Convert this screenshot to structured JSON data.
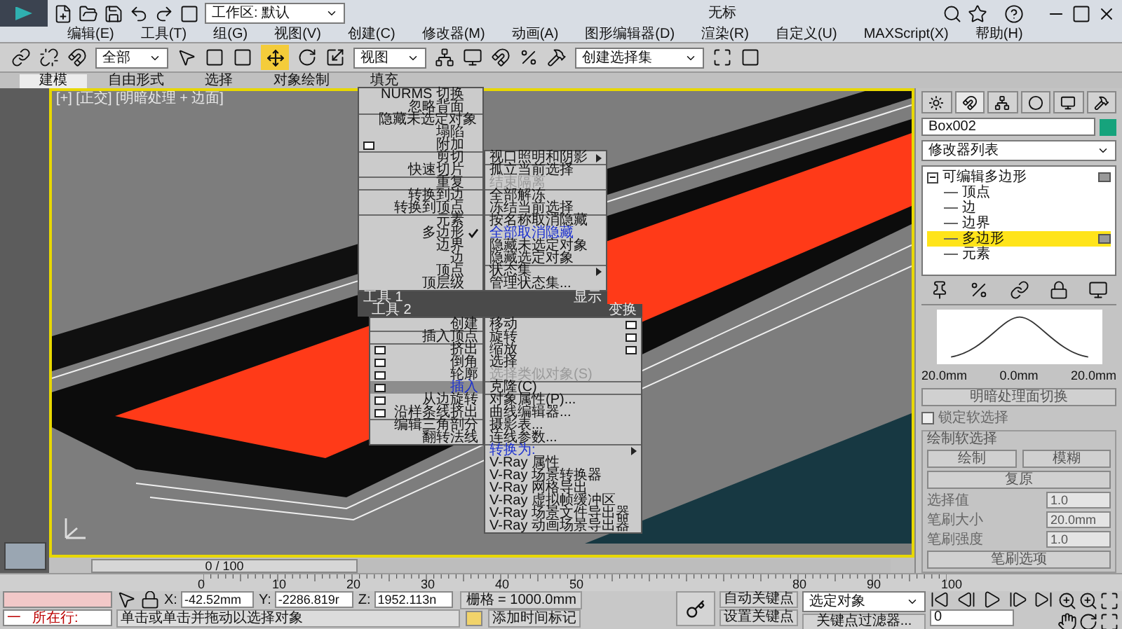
{
  "title_bar": {
    "workspace": "工作区: 默认",
    "title": "无标"
  },
  "menu_bar": [
    "编辑(E)",
    "工具(T)",
    "组(G)",
    "视图(V)",
    "创建(C)",
    "修改器(M)",
    "动画(A)",
    "图形编辑器(D)",
    "渲染(R)",
    "自定义(U)",
    "MAXScript(X)",
    "帮助(H)"
  ],
  "toolbar": {
    "selection_filter": "全部",
    "reference_coord": "视图",
    "named_selection": "创建选择集"
  },
  "ribbon_tabs": [
    {
      "label": "建模",
      "selected": true
    },
    {
      "label": "自由形式",
      "selected": false
    },
    {
      "label": "选择",
      "selected": false
    },
    {
      "label": "对象绘制",
      "selected": false
    },
    {
      "label": "填充",
      "selected": false
    }
  ],
  "viewport": {
    "label": "[+] [正交] [明暗处理 + 边面]"
  },
  "quad_menu": {
    "upper_left": {
      "label": "工具 1",
      "groups": [
        [
          {
            "label": "NURMS 切换",
            "kind": "plain",
            "checked": false,
            "selected": false,
            "disabled": false,
            "highlighted": false
          },
          {
            "label": "忽略背面",
            "kind": "plain",
            "checked": false,
            "selected": false,
            "disabled": false,
            "highlighted": false
          }
        ],
        [
          {
            "label": "隐藏未选定对象",
            "kind": "plain",
            "checked": false,
            "selected": false,
            "disabled": false,
            "highlighted": false
          },
          {
            "label": "塌陷",
            "kind": "plain",
            "checked": false,
            "selected": false,
            "disabled": false,
            "highlighted": false
          },
          {
            "label": "附加",
            "kind": "options",
            "checked": false,
            "selected": false,
            "disabled": false,
            "highlighted": false
          }
        ],
        [
          {
            "label": "剪切",
            "kind": "plain",
            "checked": false,
            "selected": false,
            "disabled": false,
            "highlighted": false
          },
          {
            "label": "快速切片",
            "kind": "plain",
            "checked": false,
            "selected": false,
            "disabled": false,
            "highlighted": false
          }
        ],
        [
          {
            "label": "重复",
            "kind": "plain",
            "checked": false,
            "selected": false,
            "disabled": false,
            "highlighted": false
          }
        ],
        [
          {
            "label": "转换到边",
            "kind": "plain",
            "checked": false,
            "selected": false,
            "disabled": false,
            "highlighted": false
          },
          {
            "label": "转换到顶点",
            "kind": "plain",
            "checked": false,
            "selected": false,
            "disabled": false,
            "highlighted": false
          }
        ],
        [
          {
            "label": "元素",
            "kind": "plain",
            "checked": false,
            "selected": false,
            "disabled": false,
            "highlighted": false
          },
          {
            "label": "多边形",
            "kind": "plain",
            "checked": true,
            "selected": false,
            "disabled": false,
            "highlighted": false
          },
          {
            "label": "边界",
            "kind": "plain",
            "checked": false,
            "selected": false,
            "disabled": false,
            "highlighted": false
          },
          {
            "label": "边",
            "kind": "plain",
            "checked": false,
            "selected": false,
            "disabled": false,
            "highlighted": false
          },
          {
            "label": "顶点",
            "kind": "plain",
            "checked": false,
            "selected": false,
            "disabled": false,
            "highlighted": false
          },
          {
            "label": "顶层级",
            "kind": "plain",
            "checked": false,
            "selected": false,
            "disabled": false,
            "highlighted": false
          }
        ]
      ]
    },
    "upper_right": {
      "label": "显示",
      "groups": [
        [
          {
            "label": "视口照明和阴影",
            "kind": "submenu",
            "selected": false,
            "disabled": false,
            "highlighted": false
          }
        ],
        [
          {
            "label": "孤立当前选择",
            "kind": "plain",
            "selected": false,
            "disabled": false,
            "highlighted": false
          },
          {
            "label": "结束隔离",
            "kind": "plain",
            "selected": false,
            "disabled": true,
            "highlighted": false
          }
        ],
        [
          {
            "label": "全部解冻",
            "kind": "plain",
            "selected": false,
            "disabled": false,
            "highlighted": false
          },
          {
            "label": "冻结当前选择",
            "kind": "plain",
            "selected": false,
            "disabled": false,
            "highlighted": false
          }
        ],
        [
          {
            "label": "按名称取消隐藏",
            "kind": "plain",
            "selected": false,
            "disabled": false,
            "highlighted": false
          },
          {
            "label": "全部取消隐藏",
            "kind": "plain",
            "selected": false,
            "disabled": false,
            "highlighted": true
          },
          {
            "label": "隐藏未选定对象",
            "kind": "plain",
            "selected": false,
            "disabled": false,
            "highlighted": false
          },
          {
            "label": "隐藏选定对象",
            "kind": "plain",
            "selected": false,
            "disabled": false,
            "highlighted": false
          }
        ],
        [
          {
            "label": "状态集",
            "kind": "submenu",
            "selected": false,
            "disabled": false,
            "highlighted": false
          },
          {
            "label": "管理状态集...",
            "kind": "plain",
            "selected": false,
            "disabled": false,
            "highlighted": false
          }
        ]
      ]
    },
    "lower_left": {
      "label": "工具 2",
      "groups": [
        [
          {
            "label": "创建",
            "kind": "plain",
            "selected": false,
            "disabled": false,
            "highlighted": false
          }
        ],
        [
          {
            "label": "插入顶点",
            "kind": "plain",
            "selected": false,
            "disabled": false,
            "highlighted": false
          }
        ],
        [
          {
            "label": "挤出",
            "kind": "options",
            "selected": false,
            "disabled": false,
            "highlighted": false
          },
          {
            "label": "倒角",
            "kind": "options",
            "selected": false,
            "disabled": false,
            "highlighted": false
          },
          {
            "label": "轮廓",
            "kind": "options",
            "selected": false,
            "disabled": false,
            "highlighted": false
          },
          {
            "label": "插入",
            "kind": "options",
            "selected": true,
            "disabled": false,
            "highlighted": true
          },
          {
            "label": "从边旋转",
            "kind": "options",
            "selected": false,
            "disabled": false,
            "highlighted": false
          },
          {
            "label": "沿样条线挤出",
            "kind": "options",
            "selected": false,
            "disabled": false,
            "highlighted": false
          }
        ],
        [
          {
            "label": "编辑三角剖分",
            "kind": "plain",
            "selected": false,
            "disabled": false,
            "highlighted": false
          },
          {
            "label": "翻转法线",
            "kind": "plain",
            "selected": false,
            "disabled": false,
            "highlighted": false
          }
        ]
      ]
    },
    "lower_right": {
      "label": "变换",
      "groups": [
        [
          {
            "label": "移动",
            "kind": "options",
            "selected": false,
            "disabled": false,
            "highlighted": false
          },
          {
            "label": "旋转",
            "kind": "options",
            "selected": false,
            "disabled": false,
            "highlighted": false
          },
          {
            "label": "缩放",
            "kind": "options",
            "selected": false,
            "disabled": false,
            "highlighted": false
          },
          {
            "label": "选择",
            "kind": "plain",
            "selected": false,
            "disabled": false,
            "highlighted": false
          },
          {
            "label": "选择类似对象(S)",
            "kind": "plain",
            "selected": false,
            "disabled": true,
            "highlighted": false
          }
        ],
        [
          {
            "label": "克隆(C)",
            "kind": "plain",
            "selected": false,
            "disabled": false,
            "highlighted": false
          }
        ],
        [
          {
            "label": "对象属性(P)...",
            "kind": "plain",
            "selected": false,
            "disabled": false,
            "highlighted": false
          },
          {
            "label": "曲线编辑器...",
            "kind": "plain",
            "selected": false,
            "disabled": false,
            "highlighted": false
          },
          {
            "label": "摄影表...",
            "kind": "plain",
            "selected": false,
            "disabled": false,
            "highlighted": false
          },
          {
            "label": "连线参数...",
            "kind": "plain",
            "selected": false,
            "disabled": false,
            "highlighted": false
          }
        ],
        [
          {
            "label": "转换为:",
            "kind": "submenu",
            "selected": false,
            "disabled": false,
            "highlighted": true
          },
          {
            "label": "V-Ray 属性",
            "kind": "plain",
            "selected": false,
            "disabled": false,
            "highlighted": false
          },
          {
            "label": "V-Ray 场景转换器",
            "kind": "plain",
            "selected": false,
            "disabled": false,
            "highlighted": false
          },
          {
            "label": "V-Ray 网格导出",
            "kind": "plain",
            "selected": false,
            "disabled": false,
            "highlighted": false
          },
          {
            "label": "V-Ray 虚拟帧缓冲区",
            "kind": "plain",
            "selected": false,
            "disabled": false,
            "highlighted": false
          },
          {
            "label": "V-Ray 场景文件导出器",
            "kind": "plain",
            "selected": false,
            "disabled": false,
            "highlighted": false
          },
          {
            "label": "V-Ray 动画场景导出器",
            "kind": "plain",
            "selected": false,
            "disabled": false,
            "highlighted": false
          }
        ]
      ]
    }
  },
  "command_panel": {
    "object_name": "Box002",
    "modifier_list": "修改器列表",
    "stack": [
      {
        "label": "可编辑多边形",
        "expanded": true,
        "children": [
          {
            "label": "顶点",
            "selected": false
          },
          {
            "label": "边",
            "selected": false
          },
          {
            "label": "边界",
            "selected": false
          },
          {
            "label": "多边形",
            "selected": true
          },
          {
            "label": "元素",
            "selected": false
          }
        ]
      }
    ],
    "falloff_labels": [
      "20.0mm",
      "0.0mm",
      "20.0mm"
    ],
    "shade_toggle": "明暗处理面切换",
    "lock_soft_selection": {
      "label": "锁定软选择",
      "checked": false
    },
    "paint_group": {
      "title": "绘制软选择",
      "buttons": [
        "绘制",
        "模糊"
      ],
      "revert": "复原",
      "fields": [
        {
          "label": "选择值",
          "value": "1.0"
        },
        {
          "label": "笔刷大小",
          "value": "20.0mm"
        },
        {
          "label": "笔刷强度",
          "value": "1.0"
        }
      ],
      "options": "笔刷选项"
    }
  },
  "timeline": {
    "position": "0 / 100",
    "level": 0,
    "ruler_labels": [
      "0",
      "10",
      "20",
      "30",
      "40",
      "50",
      "80",
      "90",
      "100"
    ]
  },
  "status_bar": {
    "listener_prefix": "一",
    "listener_label": "所在行:",
    "x_label": "X:",
    "y_label": "Y:",
    "z_label": "Z:",
    "x": "-42.52mm",
    "y": "-2286.819r",
    "z": "1952.113n",
    "grid": "栅格 = 1000.0mm",
    "auto_key": "自动关键点",
    "set_key": "设置关键点",
    "key_target": "选定对象",
    "key_filters": "关键点过滤器...",
    "frame": "0",
    "prompt": "单击或单击并拖动以选择对象",
    "add_time_tag": "添加时间标记"
  }
}
